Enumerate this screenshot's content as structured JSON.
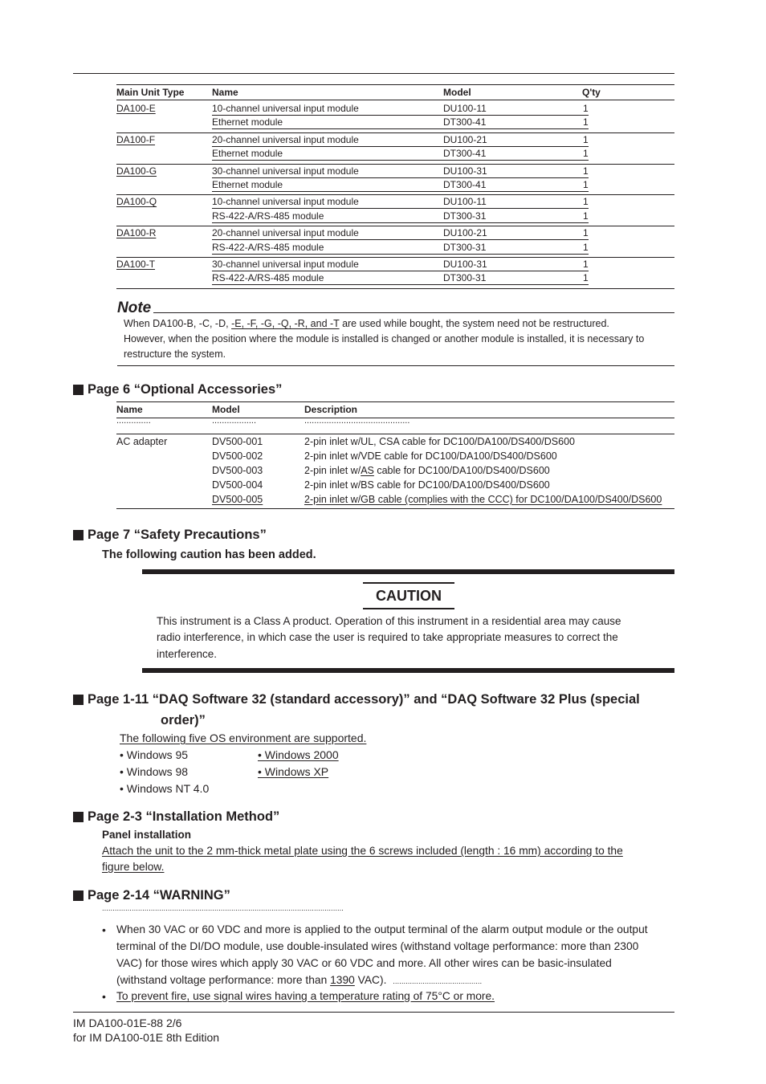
{
  "main_unit_table": {
    "headers": {
      "type": "Main Unit Type",
      "name": "Name",
      "model": "Model",
      "qty": "Q'ty"
    },
    "groups": [
      {
        "type": "DA100-E",
        "rows": [
          {
            "name": "10-channel universal input module",
            "model": "DU100-11",
            "qty": "1"
          },
          {
            "name": "Ethernet module",
            "model": "DT300-41",
            "qty": "1"
          }
        ]
      },
      {
        "type": "DA100-F",
        "rows": [
          {
            "name": "20-channel universal input module",
            "model": "DU100-21",
            "qty": "1"
          },
          {
            "name": "Ethernet module",
            "model": "DT300-41",
            "qty": "1"
          }
        ]
      },
      {
        "type": "DA100-G",
        "rows": [
          {
            "name": "30-channel universal input module",
            "model": "DU100-31",
            "qty": "1"
          },
          {
            "name": "Ethernet module",
            "model": "DT300-41",
            "qty": "1"
          }
        ]
      },
      {
        "type": "DA100-Q",
        "rows": [
          {
            "name": "10-channel universal input module",
            "model": "DU100-11",
            "qty": "1"
          },
          {
            "name": "RS-422-A/RS-485 module",
            "model": "DT300-31",
            "qty": "1"
          }
        ]
      },
      {
        "type": "DA100-R",
        "rows": [
          {
            "name": "20-channel universal input module",
            "model": "DU100-21",
            "qty": "1"
          },
          {
            "name": "RS-422-A/RS-485 module",
            "model": "DT300-31",
            "qty": "1"
          }
        ]
      },
      {
        "type": "DA100-T",
        "rows": [
          {
            "name": "30-channel universal input module",
            "model": "DU100-31",
            "qty": "1"
          },
          {
            "name": "RS-422-A/RS-485 module",
            "model": "DT300-31",
            "qty": "1"
          }
        ]
      }
    ]
  },
  "note": {
    "title": "Note",
    "line1_pre": "When DA100-B, -C, -D, ",
    "line1_underlined": "-E, -F, -G, -Q, -R, and -T",
    "line1_post": " are used while bought, the system need not be restructured.",
    "line2": "However, when the position where the module is installed is changed or another module is installed, it is necessary to",
    "line3": "restructure the system."
  },
  "sections": {
    "accessories": {
      "heading": "Page 6  “Optional Accessories”",
      "headers": {
        "name": "Name",
        "model": "Model",
        "description": "Description"
      },
      "ellipsis": {
        "name": "..............",
        "model": "..................",
        "description": "..........................................."
      },
      "item_name": "AC adapter",
      "rows": [
        {
          "model": "DV500-001",
          "desc_pre": "2-pin inlet w/UL, CSA cable for DC100/DA100/DS400/DS600",
          "desc_u": "",
          "desc_post": ""
        },
        {
          "model": "DV500-002",
          "desc_pre": "2-pin inlet w/VDE cable for DC100/DA100/DS400/DS600",
          "desc_u": "",
          "desc_post": ""
        },
        {
          "model": "DV500-003",
          "desc_pre": "2-pin inlet w/",
          "desc_u": "AS",
          "desc_post": " cable for DC100/DA100/DS400/DS600"
        },
        {
          "model": "DV500-004",
          "desc_pre": "2-pin inlet w/BS cable for DC100/DA100/DS400/DS600",
          "desc_u": "",
          "desc_post": ""
        },
        {
          "model": "DV500-005",
          "desc_pre": "",
          "desc_u": "2-pin inlet w/GB cable (complies with the CCC) for DC100/DA100/DS400/DS600",
          "desc_post": ""
        }
      ]
    },
    "safety": {
      "heading": "Page 7  “Safety Precautions”",
      "subheading": "The following caution has been added.",
      "caution_title": "CAUTION",
      "caution_lines": [
        "This instrument is a Class A product. Operation of this instrument in a residential area may cause",
        "radio interference, in which case the user is required to take appropriate measures to correct the",
        "interference."
      ]
    },
    "software": {
      "heading_line1": "Page 1-11  “DAQ Software 32 (standard accessory)” and “DAQ Software 32 Plus (special",
      "heading_line2": "order)”",
      "intro": "The following five OS environment are supported.",
      "os_left": [
        "• Windows 95",
        "• Windows 98",
        "• Windows NT 4.0"
      ],
      "os_right": [
        "• Windows 2000",
        "• Windows XP"
      ]
    },
    "installation": {
      "heading": "Page 2-3  “Installation Method”",
      "subheading": "Panel installation",
      "line1": "Attach the unit to the 2 mm-thick metal plate using the 6 screws included (length : 16 mm) according to the",
      "line2": "figure below."
    },
    "warning": {
      "heading": "Page 2-14  “WARNING”",
      "dots": "..................................................................................................................",
      "bullet1_lines": [
        "When 30 VAC or 60 VDC and more is applied to the output terminal of the alarm output module or the output",
        "terminal of the DI/DO module, use double-insulated wires (withstand voltage performance: more than 2300",
        "VAC) for those wires which apply 30 VAC or 60 VDC and more.  All other wires can be basic-insulated"
      ],
      "bullet1_last_pre": "(withstand voltage performance: more than ",
      "bullet1_last_u": "1390",
      "bullet1_last_post": " VAC).",
      "bullet1_trail_dots": "..........................................",
      "bullet2": "To prevent fire, use signal wires having a temperature rating of 75°C or more.",
      "bullet_char": "•"
    }
  },
  "footer": {
    "line1": "IM DA100-01E-88  2/6",
    "line2": "for IM DA100-01E 8th Edition"
  }
}
